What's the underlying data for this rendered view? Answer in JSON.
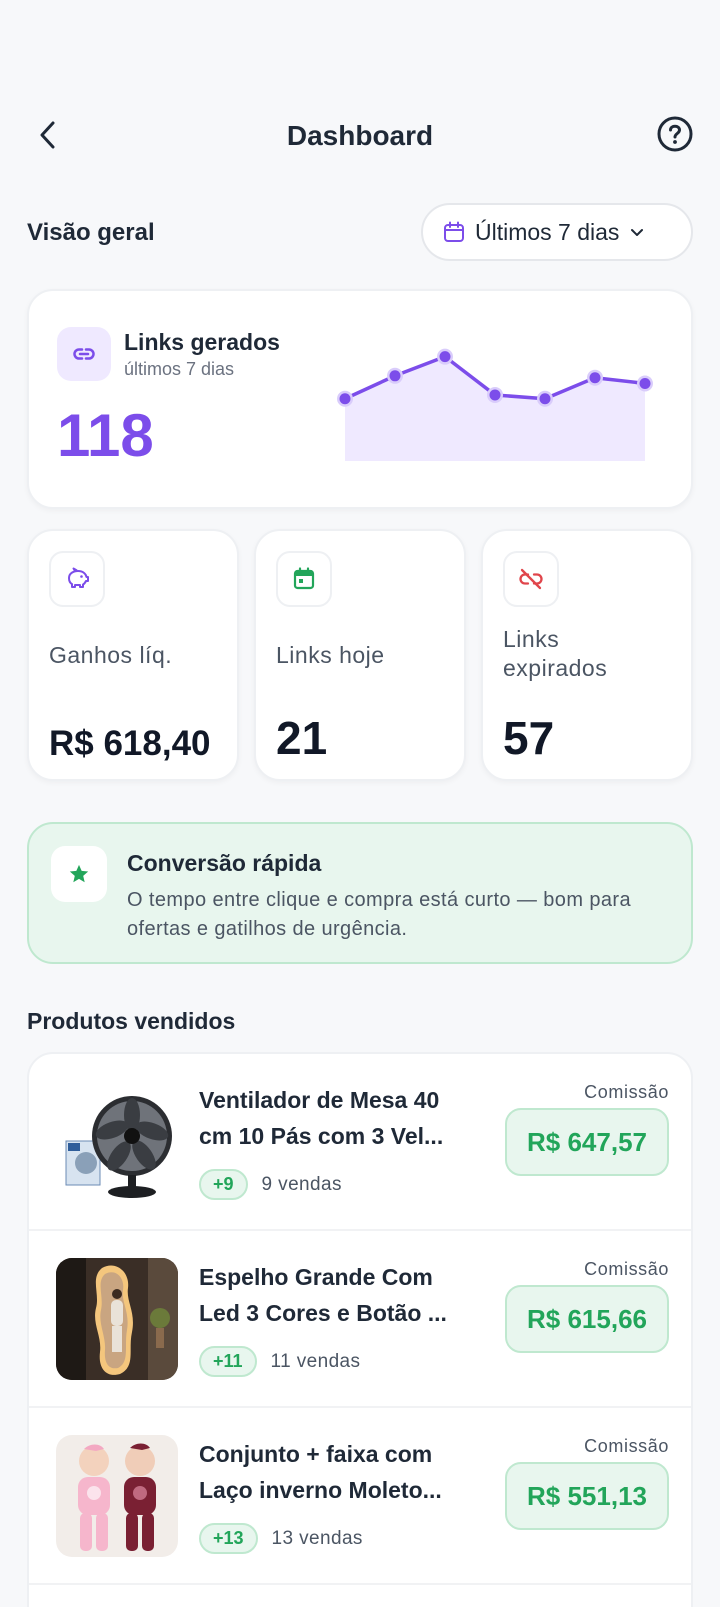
{
  "header": {
    "title": "Dashboard"
  },
  "overview": {
    "label": "Visão geral",
    "range": "Últimos 7 dias"
  },
  "links_card": {
    "title": "Links gerados",
    "subtitle": "últimos 7 dias",
    "value": "118",
    "accent": "#7c4dea",
    "trend": [
      44,
      56,
      66,
      46,
      44,
      55,
      52
    ]
  },
  "stats": [
    {
      "icon": "piggy-bank-icon",
      "label": "Ganhos líq.",
      "value": "R$ 618,40"
    },
    {
      "icon": "calendar-icon",
      "label": "Links hoje",
      "value": "21"
    },
    {
      "icon": "link-off-icon",
      "label": "Links expirados",
      "value": "57"
    }
  ],
  "tip": {
    "icon": "star-icon",
    "title": "Conversão rápida",
    "text": "O tempo entre clique e compra está curto — bom para ofertas e gatilhos de urgência."
  },
  "products_section": {
    "title": "Produtos vendidos"
  },
  "products": [
    {
      "line1": "Ventilador de Mesa 40",
      "line2": "cm 10 Pás com 3 Vel...",
      "badge": "+9",
      "sales": "9 vendas",
      "comm_label": "Comissão",
      "commission": "R$ 647,57"
    },
    {
      "line1": "Espelho Grande Com",
      "line2": "Led 3 Cores e Botão ...",
      "badge": "+11",
      "sales": "11 vendas",
      "comm_label": "Comissão",
      "commission": "R$ 615,66"
    },
    {
      "line1": "Conjunto + faixa com",
      "line2": "Laço inverno Moleto...",
      "badge": "+13",
      "sales": "13 vendas",
      "comm_label": "Comissão",
      "commission": "R$ 551,13"
    }
  ],
  "colors": {
    "green": "#22a55a",
    "purple": "#7c4dea",
    "red": "#e0454b"
  }
}
